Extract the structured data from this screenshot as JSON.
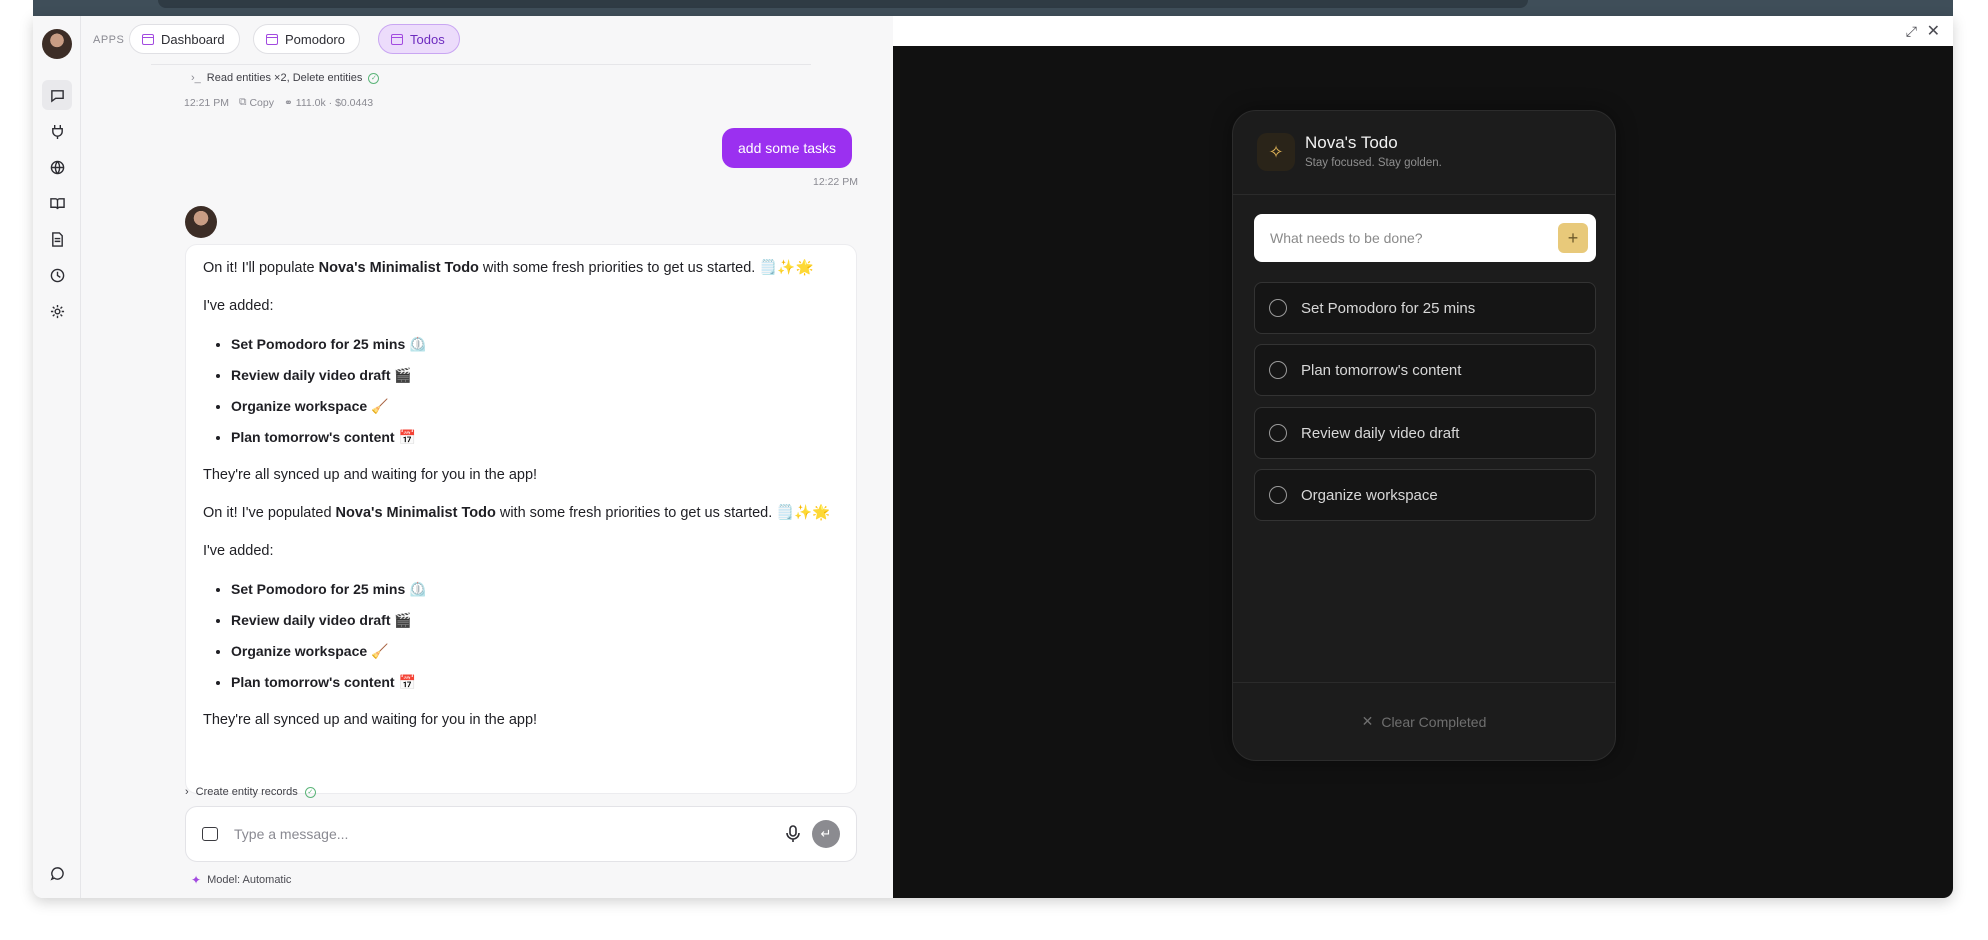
{
  "apps": {
    "label": "APPS",
    "tabs": [
      {
        "label": "Dashboard"
      },
      {
        "label": "Pomodoro"
      },
      {
        "label": "Todos"
      }
    ]
  },
  "history": {
    "tool_summary": "Read entities ×2, Delete entities",
    "time": "12:21 PM",
    "copy_label": "Copy",
    "usage": "111.0k · $0.0443"
  },
  "user_message": {
    "text": "add some tasks",
    "time": "12:22 PM"
  },
  "assistant": {
    "intro1_pre": "On it! I'll populate ",
    "app_name": "Nova's Minimalist Todo",
    "intro1_post": " with some fresh priorities to get us started. 🗒️✨🌟",
    "added_label": "I've added:",
    "tasks": [
      "Set Pomodoro for 25 mins ⏲️",
      "Review daily video draft 🎬",
      "Organize workspace 🧹",
      "Plan tomorrow's content 📅"
    ],
    "outro": "They're all synced up and waiting for you in the app!",
    "intro2_pre": "On it! I've populated ",
    "intro2_post": " with some fresh priorities to get us started. 🗒️✨🌟",
    "tool_next": "Create entity records"
  },
  "composer": {
    "placeholder": "Type a message...",
    "model": "Model: Automatic"
  },
  "todo_app": {
    "title": "Nova's Todo",
    "subtitle": "Stay focused. Stay golden.",
    "input_placeholder": "What needs to be done?",
    "items": [
      "Set Pomodoro for 25 mins",
      "Plan tomorrow's content",
      "Review daily video draft",
      "Organize workspace"
    ],
    "clear_label": "Clear Completed"
  },
  "colors": {
    "accent": "#9b30f0",
    "gold": "#e8c97a"
  }
}
